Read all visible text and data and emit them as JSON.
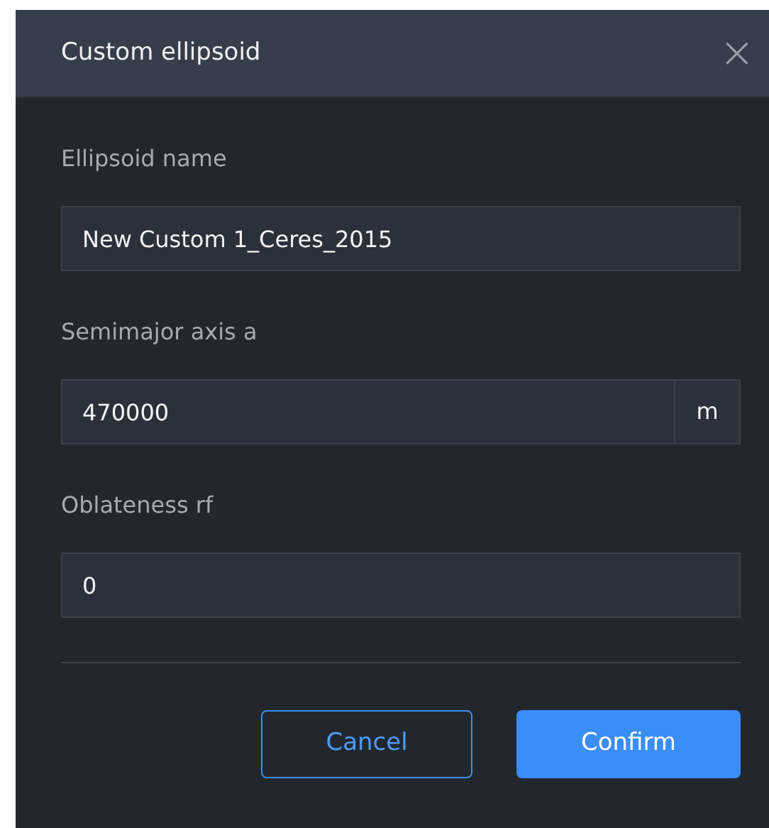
{
  "dialog": {
    "title": "Custom ellipsoid",
    "close": "×"
  },
  "fields": [
    {
      "label": "Ellipsoid name",
      "value": "New Custom 1_Ceres_2015"
    },
    {
      "label": "Semimajor axis a",
      "value": "470000",
      "unit": "m"
    },
    {
      "label": "Oblateness rf",
      "value": "0"
    }
  ],
  "buttons": [
    {
      "label": "Cancel",
      "kind": "secondary"
    },
    {
      "label": "Confirm",
      "kind": "primary"
    }
  ]
}
